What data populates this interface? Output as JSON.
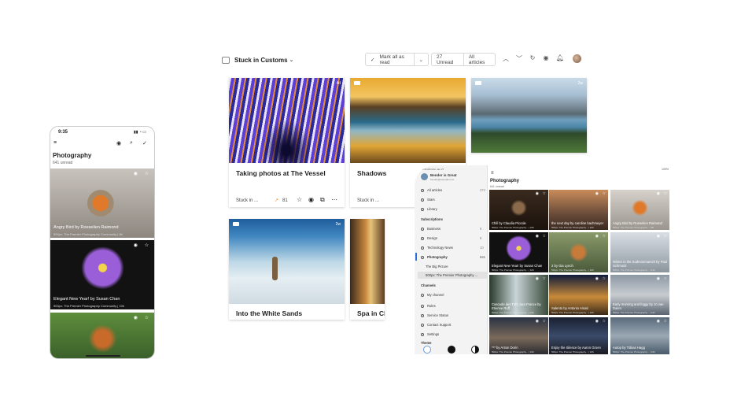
{
  "desktop": {
    "feed_title": "Stuck in Customs",
    "chevron": "⌄",
    "mark_all_read": "Mark all as read",
    "unread_count": "27 Unread",
    "all_articles": "All articles",
    "cards": [
      {
        "title": "Taking photos at The Vessel",
        "badge": "4d",
        "source": "Stuck in ...",
        "count": "81"
      },
      {
        "title": "Shadows",
        "badge": "",
        "source": "Stuck in ..."
      },
      {
        "title": "",
        "badge": "2w"
      },
      {
        "title": "Into the White Sands",
        "badge": "2w"
      },
      {
        "title": "Spa in Ch",
        "badge": ""
      }
    ]
  },
  "phone": {
    "time": "9:35",
    "title": "Photography",
    "unread": "641 unread",
    "items": [
      {
        "caption": "Angry Bird by Roeselien Raimond",
        "sub": "500px: The Premier Photography Community | 8h"
      },
      {
        "caption": "Elegant New Year! by Susan Chan",
        "sub": "500px: The Premier Photography Community | 10h"
      },
      {
        "caption": "",
        "sub": ""
      }
    ]
  },
  "tablet": {
    "status_time": "10:34 AM  Mon Jan 27",
    "battery": "100%",
    "user_name": "Bender is Great",
    "user_email": "bender@example.com",
    "side_items": [
      {
        "label": "All articles",
        "count": "374"
      },
      {
        "label": "Stars",
        "count": ""
      },
      {
        "label": "Library",
        "count": ""
      },
      {
        "label": "Subscriptions",
        "count": ""
      },
      {
        "label": "Business",
        "count": "5"
      },
      {
        "label": "Design",
        "count": "8"
      },
      {
        "label": "Technology News",
        "count": "10"
      },
      {
        "label": "Photography",
        "count": "641"
      },
      {
        "label": "The Big Picture",
        "count": ""
      },
      {
        "label": "500px: The Premier Photography ...",
        "count": ""
      },
      {
        "label": "Channels",
        "count": ""
      },
      {
        "label": "My channel",
        "count": ""
      },
      {
        "label": "Rules",
        "count": ""
      },
      {
        "label": "Service Status",
        "count": ""
      },
      {
        "label": "Contact Support",
        "count": ""
      },
      {
        "label": "Settings",
        "count": ""
      },
      {
        "label": "Theme",
        "count": ""
      }
    ],
    "main_title": "Photography",
    "main_unread": "641 unread",
    "tiles": [
      {
        "caption": "Chill by Claudia Piccole",
        "sub": "500px: The Premier Photography... | 10h"
      },
      {
        "caption": "the next day by caroline bachmeyer",
        "sub": "500px: The Premier Photography... | 10h"
      },
      {
        "caption": "Angry Bird by Roeselien Raimond",
        "sub": "500px: The Premier Photography... | 8h"
      },
      {
        "caption": "Elegant New Year! by Susan Chan",
        "sub": "500px: The Premier Photography... | 10h"
      },
      {
        "caption": "2 by Gia Lynch",
        "sub": "500px: The Premier Photography... | 10h"
      },
      {
        "caption": "Winter in the Sudmonmarsch by Paul Schmuck",
        "sub": "500px: The Premier Photography... | 10h"
      },
      {
        "caption": "Cascade des Tufs Jura France by Etienne Ruff",
        "sub": "500px: The Premier Photography... | 10h"
      },
      {
        "caption": "Salento by Antonio Amati",
        "sub": "500px: The Premier Photography... | 10h"
      },
      {
        "caption": "Early morning and foggy by Jo van Dalen",
        "sub": "500px: The Premier Photography... | 10h"
      },
      {
        "caption": "*** by Anton Dorin",
        "sub": "500px: The Premier Photography... | 10h"
      },
      {
        "caption": "Enjoy the Silence by Aaron Groen",
        "sub": "500px: The Premier Photography... | 10h"
      },
      {
        "caption": "Autop by Tobias Hagg",
        "sub": "500px: The Premier Photography... | 10h"
      }
    ]
  }
}
